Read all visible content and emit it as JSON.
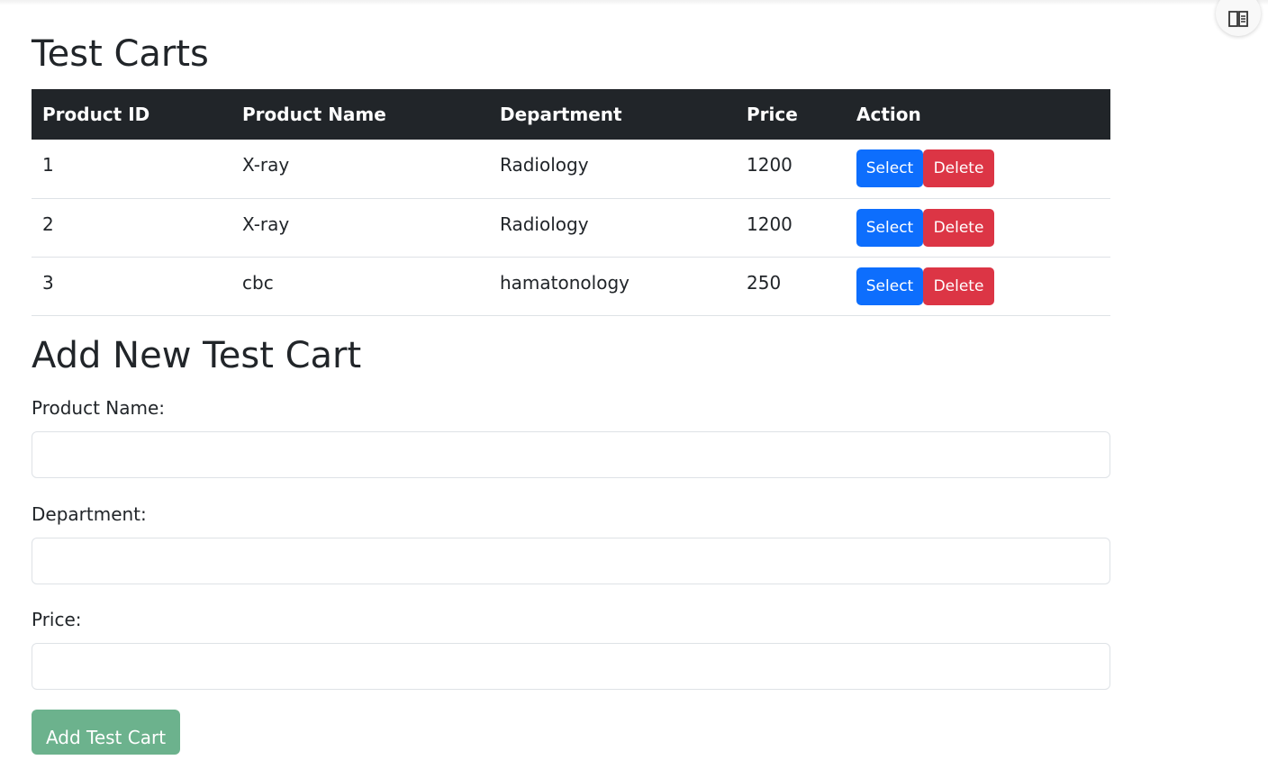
{
  "header": {
    "title": "Test Carts"
  },
  "table": {
    "columns": [
      "Product ID",
      "Product Name",
      "Department",
      "Price",
      "Action"
    ],
    "rows": [
      {
        "id": "1",
        "name": "X-ray",
        "department": "Radiology",
        "price": "1200"
      },
      {
        "id": "2",
        "name": "X-ray",
        "department": "Radiology",
        "price": "1200"
      },
      {
        "id": "3",
        "name": "cbc",
        "department": "hamatonology",
        "price": "250"
      }
    ],
    "select_label": "Select",
    "delete_label": "Delete"
  },
  "form": {
    "title": "Add New Test Cart",
    "product_name_label": "Product Name:",
    "department_label": "Department:",
    "price_label": "Price:",
    "product_name_value": "",
    "department_value": "",
    "price_value": "",
    "submit_label": "Add Test Cart"
  },
  "icons": {
    "reader": "reader-mode-icon"
  },
  "colors": {
    "header_bg": "#212529",
    "select": "#0d6efd",
    "delete": "#dc3545",
    "submit": "#6cb28d"
  }
}
